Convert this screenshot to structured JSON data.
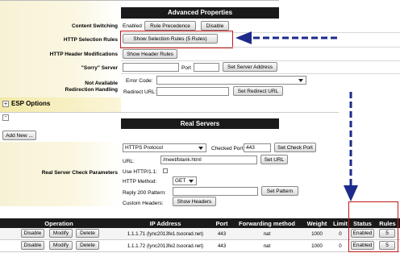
{
  "advanced_properties": {
    "header": "Advanced Properties",
    "content_switching": {
      "label": "Content Switching",
      "status": "Enabled",
      "rule_precedence_button": "Rule Precedence",
      "disable_button": "Disable"
    },
    "http_selection_rules": {
      "label": "HTTP Selection Rules",
      "button": "Show Selection Rules (5 Rules)"
    },
    "http_header_mods": {
      "label": "HTTP Header Modifications",
      "button": "Show Header Rules"
    },
    "sorry_server": {
      "label": "\"Sorry\" Server",
      "port_label": "Port",
      "set_button": "Set Server Address"
    },
    "not_available": {
      "label_line1": "Not Available",
      "label_line2": "Redirection Handling",
      "error_code_label": "Error Code:",
      "redirect_url_label": "Redirect URL:",
      "set_button": "Set Redirect URL"
    }
  },
  "esp_options": {
    "toggle": "+",
    "label": "ESP Options"
  },
  "section_toggle": "-",
  "add_new_button": "Add New ...",
  "real_servers": {
    "header": "Real Servers",
    "check_params_label": "Real Server Check Parameters",
    "protocol_value": "HTTPS Protocol",
    "checked_port_label": "Checked Port",
    "checked_port_value": "443",
    "set_check_port_button": "Set Check Port",
    "url_label": "URL:",
    "url_value": "/meet/blank.html",
    "set_url_button": "Set URL",
    "use_http11_label": "Use HTTP/1.1:",
    "http_method_label": "HTTP Method:",
    "http_method_value": "GET",
    "reply200_label": "Reply 200 Pattern:",
    "set_pattern_button": "Set Pattern",
    "custom_headers_label": "Custom Headers:",
    "show_headers_button": "Show Headers"
  },
  "table": {
    "columns": [
      "Operation",
      "IP Address",
      "Port",
      "Forwarding method",
      "Weight",
      "Limit",
      "Status",
      "Rules"
    ],
    "rows": [
      {
        "disable": "Disable",
        "modify": "Modify",
        "delete": "Delete",
        "ip": "1.1.1.71 (lync2013fe1.tsoorad.net)",
        "port": "443",
        "method": "nat",
        "weight": "1000",
        "limit": "0",
        "status": "Enabled",
        "rules": "5"
      },
      {
        "disable": "Disable",
        "modify": "Modify",
        "delete": "Delete",
        "ip": "1.1.1.72 (lync2013fe2.tsoorad.net)",
        "port": "443",
        "method": "nat",
        "weight": "1000",
        "limit": "0",
        "status": "Enabled",
        "rules": "5"
      }
    ]
  },
  "colors": {
    "header_bg": "#1a1a1a",
    "highlight": "#c01818",
    "arrow": "#1c2a8c",
    "panel": "#f7f2d6"
  }
}
